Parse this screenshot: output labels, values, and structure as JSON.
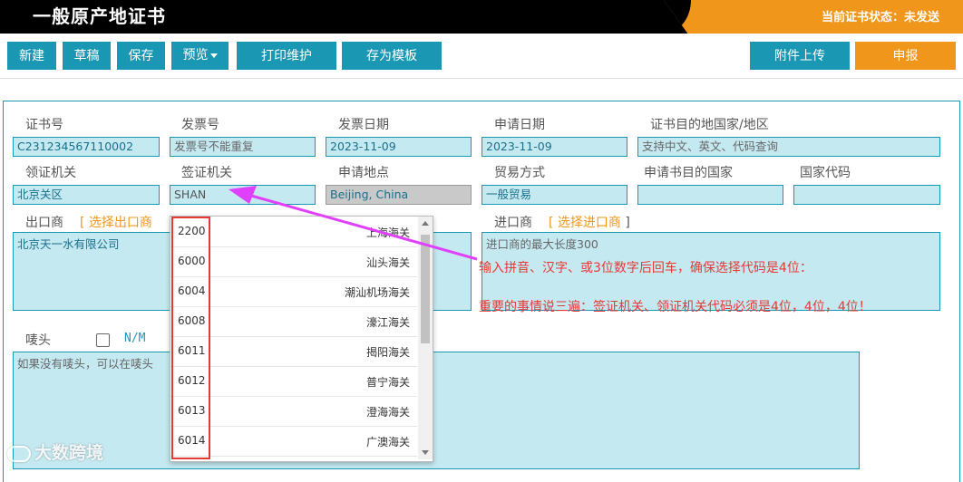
{
  "header": {
    "title": "一般原产地证书",
    "status": "当前证书状态：未发送"
  },
  "toolbar": {
    "new": "新建",
    "draft": "草稿",
    "save": "保存",
    "preview": "预览",
    "print": "打印维护",
    "template": "存为模板",
    "upload": "附件上传",
    "submit": "申报"
  },
  "form": {
    "cert_no_label": "证书号",
    "cert_no": "C231234567110002",
    "invoice_no_label": "发票号",
    "invoice_no_placeholder": "发票号不能重复",
    "invoice_date_label": "发票日期",
    "invoice_date": "2023-11-09",
    "apply_date_label": "申请日期",
    "apply_date": "2023-11-09",
    "dest_label": "证书目的地国家/地区",
    "dest_placeholder": "支持中文、英文、代码查询",
    "issuing_label": "领证机关",
    "issuing": "北京关区",
    "visa_label": "签证机关",
    "visa": "SHAN",
    "apply_place_label": "申请地点",
    "apply_place": "Beijing, China",
    "trade_label": "贸易方式",
    "trade": "一般贸易",
    "apply_country_label": "申请书目的国家",
    "apply_country": "",
    "country_code_label": "国家代码",
    "country_code": "",
    "exporter_label": "出口商",
    "exporter_select": "选择出口商",
    "exporter": "北京天一水有限公司",
    "importer_label": "进口商",
    "importer_select": "选择进口商",
    "importer_placeholder": "进口商的最大长度300",
    "mark_label": "唛头",
    "nm": "N/M",
    "mark_placeholder": "如果没有唛头，可以在唛头"
  },
  "dropdown": {
    "items": [
      {
        "code": "2200",
        "name": "上海海关"
      },
      {
        "code": "6000",
        "name": "汕头海关"
      },
      {
        "code": "6004",
        "name": "潮汕机场海关"
      },
      {
        "code": "6008",
        "name": "濠江海关"
      },
      {
        "code": "6011",
        "name": "揭阳海关"
      },
      {
        "code": "6012",
        "name": "普宁海关"
      },
      {
        "code": "6013",
        "name": "澄海海关"
      },
      {
        "code": "6014",
        "name": "广澳海关"
      }
    ]
  },
  "annotation": {
    "line1": "输入拼音、汉字、或3位数字后回车，确保选择代码是4位：",
    "line2": "重要的事情说三遍：签证机关、领证机关代码必须是4位，4位，4位！"
  },
  "watermark": "大数跨境",
  "colors": {
    "teal": "#1a98b3",
    "orange": "#f0961b",
    "field_bg": "#c5e9f1",
    "annotation": "#e53935",
    "arrow": "#e040fb"
  }
}
